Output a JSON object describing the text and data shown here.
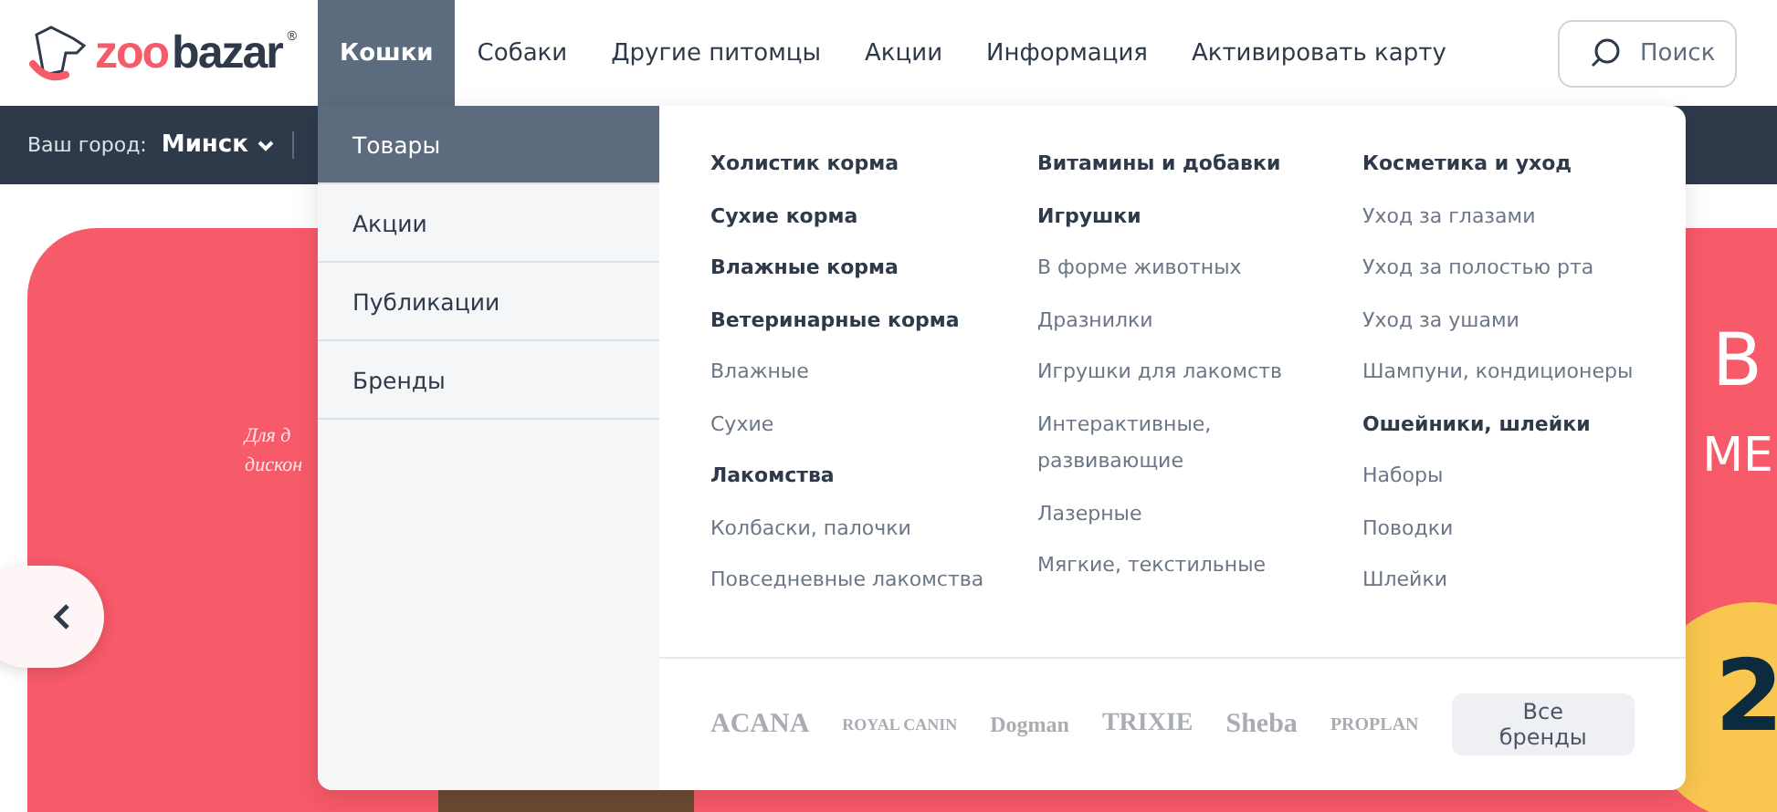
{
  "logo": {
    "first": "zoo",
    "second": "bazar",
    "mark": "®"
  },
  "nav": [
    {
      "label": "Кошки",
      "selected": true
    },
    {
      "label": "Собаки",
      "selected": false
    },
    {
      "label": "Другие питомцы",
      "selected": false
    },
    {
      "label": "Акции",
      "selected": false
    },
    {
      "label": "Информация",
      "selected": false
    },
    {
      "label": "Активировать карту",
      "selected": false
    }
  ],
  "search": {
    "label": "Поиск"
  },
  "city": {
    "label": "Ваш город:",
    "value": "Минск"
  },
  "hero": {
    "texts": [
      "Для д",
      "дискон"
    ],
    "title": "В",
    "subtitle": "МЕ",
    "badge": "2"
  },
  "menu": {
    "sections": [
      {
        "label": "Товары",
        "selected": true
      },
      {
        "label": "Акции",
        "selected": false
      },
      {
        "label": "Публикации",
        "selected": false
      },
      {
        "label": "Бренды",
        "selected": false
      }
    ],
    "columns": [
      [
        {
          "label": "Холистик корма",
          "kind": "heading"
        },
        {
          "label": "Сухие корма",
          "kind": "heading"
        },
        {
          "label": "Влажные корма",
          "kind": "heading"
        },
        {
          "label": "Ветеринарные корма",
          "kind": "heading"
        },
        {
          "label": "Влажные",
          "kind": "link"
        },
        {
          "label": "Сухие",
          "kind": "link"
        },
        {
          "label": "Лакомства",
          "kind": "heading"
        },
        {
          "label": "Колбаски, палочки",
          "kind": "link"
        },
        {
          "label": "Повседневные лакомства",
          "kind": "link"
        }
      ],
      [
        {
          "label": "Витамины и добавки",
          "kind": "heading"
        },
        {
          "label": "Игрушки",
          "kind": "heading"
        },
        {
          "label": "В форме животных",
          "kind": "link"
        },
        {
          "label": "Дразнилки",
          "kind": "link"
        },
        {
          "label": "Игрушки для лакомств",
          "kind": "link"
        },
        {
          "label": "Интерактивные, развивающие",
          "kind": "link"
        },
        {
          "label": "Лазерные",
          "kind": "link"
        },
        {
          "label": "Мягкие, текстильные",
          "kind": "link"
        }
      ],
      [
        {
          "label": "Косметика и уход",
          "kind": "heading"
        },
        {
          "label": "Уход за глазами",
          "kind": "link"
        },
        {
          "label": "Уход за полостью рта",
          "kind": "link"
        },
        {
          "label": "Уход за ушами",
          "kind": "link"
        },
        {
          "label": "Шампуни, кондиционеры",
          "kind": "link"
        },
        {
          "label": "Ошейники, шлейки",
          "kind": "heading"
        },
        {
          "label": "Наборы",
          "kind": "link"
        },
        {
          "label": "Поводки",
          "kind": "link"
        },
        {
          "label": "Шлейки",
          "kind": "link"
        }
      ]
    ],
    "brands": [
      "ACANA",
      "ROYAL CANIN",
      "Dogman",
      "TRIXIE",
      "Sheba",
      "PROPLAN"
    ],
    "all_brands": "Все бренды"
  }
}
